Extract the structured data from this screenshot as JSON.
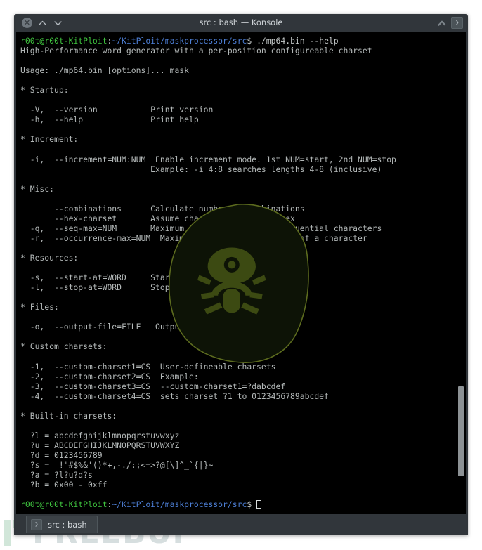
{
  "window": {
    "title": "src : bash — Konsole",
    "titlebar": {
      "close_label": "✕",
      "shade_up_label": "⌃",
      "shade_down_label": "⌄",
      "collapse_label": "⌃",
      "tab_button_label": "❯"
    }
  },
  "tabbar": {
    "tabs": [
      {
        "label": "src : bash",
        "icon_label": "❯"
      }
    ]
  },
  "terminal": {
    "prompt": {
      "user_host": "r00t@r00t-KitPloit",
      "separator": ":",
      "path": "~/KitPloit/maskprocessor/src",
      "sigil": "$ "
    },
    "command": "./mp64.bin --help",
    "output": "High-Performance word generator with a per-position configureable charset\n\nUsage: ./mp64.bin [options]... mask\n\n* Startup:\n\n  -V,  --version           Print version\n  -h,  --help              Print help\n\n* Increment:\n\n  -i,  --increment=NUM:NUM  Enable increment mode. 1st NUM=start, 2nd NUM=stop\n                           Example: -i 4:8 searches lengths 4-8 (inclusive)\n\n* Misc:\n\n       --combinations      Calculate number of combinations\n       --hex-charset       Assume charset is given in hex\n  -q,  --seq-max=NUM       Maximum number of multiple sequential characters\n  -r,  --occurrence-max=NUM  Maximum number of occurrence of a character\n\n* Resources:\n\n  -s,  --start-at=WORD     Start at specific position\n  -l,  --stop-at=WORD      Stop at specific position\n\n* Files:\n\n  -o,  --output-file=FILE   Output-file\n\n* Custom charsets:\n\n  -1,  --custom-charset1=CS  User-defineable charsets\n  -2,  --custom-charset2=CS  Example:\n  -3,  --custom-charset3=CS  --custom-charset1=?dabcdef\n  -4,  --custom-charset4=CS  sets charset ?1 to 0123456789abcdef\n\n* Built-in charsets:\n\n  ?l = abcdefghijklmnopqrstuvwxyz\n  ?u = ABCDEFGHIJKLMNOPQRSTUVWXYZ\n  ?d = 0123456789\n  ?s =  !\"#$%&'()*+,-./:;<=>?@[\\]^_`{|}~\n  ?a = ?l?u?d?s\n  ?b = 0x00 - 0xff",
    "cursor_visible": true,
    "colors": {
      "background": "#000000",
      "foreground": "#b3b8b8",
      "prompt_user": "#3fc43f",
      "prompt_path": "#4d7fd6",
      "window_chrome": "#31363b"
    }
  },
  "watermark": {
    "text": "FREEBUF"
  }
}
